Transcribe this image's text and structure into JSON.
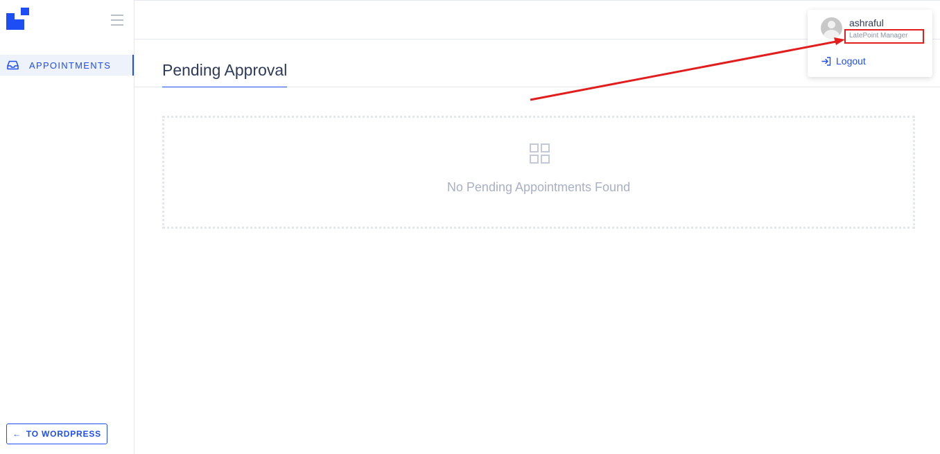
{
  "sidebar": {
    "items": [
      {
        "label": "APPOINTMENTS",
        "icon": "inbox-icon"
      }
    ],
    "back_button_label": "TO WORDPRESS",
    "back_button_icon": "arrow-left-icon"
  },
  "main": {
    "page_title": "Pending Approval",
    "empty_state": {
      "icon": "grid-icon",
      "message": "No Pending Appointments Found"
    }
  },
  "user_menu": {
    "name": "ashraful",
    "role": "LatePoint Manager",
    "logout_label": "Logout",
    "logout_icon": "logout-icon"
  },
  "colors": {
    "accent": "#1c4df5",
    "annotation": "#e11d1d",
    "muted": "#a8b0c4"
  }
}
